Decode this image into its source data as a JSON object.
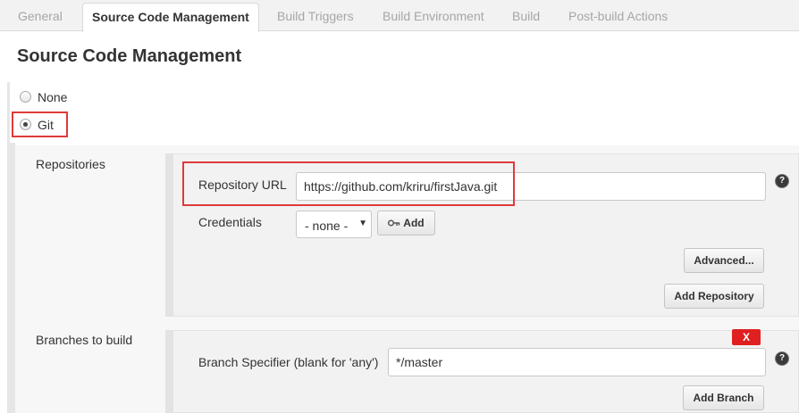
{
  "tabs": [
    {
      "label": "General",
      "active": false
    },
    {
      "label": "Source Code Management",
      "active": true
    },
    {
      "label": "Build Triggers",
      "active": false
    },
    {
      "label": "Build Environment",
      "active": false
    },
    {
      "label": "Build",
      "active": false
    },
    {
      "label": "Post-build Actions",
      "active": false
    }
  ],
  "section_title": "Source Code Management",
  "scm_options": [
    {
      "label": "None",
      "selected": false
    },
    {
      "label": "Git",
      "selected": true
    }
  ],
  "repositories": {
    "label": "Repositories",
    "url_label": "Repository URL",
    "url_value": "https://github.com/kriru/firstJava.git",
    "credentials_label": "Credentials",
    "credentials_value": "- none -",
    "add_label": "Add",
    "advanced_label": "Advanced...",
    "add_repository_label": "Add Repository"
  },
  "branches": {
    "label": "Branches to build",
    "delete_label": "X",
    "specifier_label": "Branch Specifier (blank for 'any')",
    "specifier_value": "*/master",
    "add_branch_label": "Add Branch"
  },
  "colors": {
    "highlight": "#e03a3a",
    "delete_button": "#e02020",
    "inactive_tab_text": "#a6a6a6"
  },
  "icons": {
    "help": "question-circle-icon",
    "key": "key-icon",
    "dropdown": "chevron-down-icon",
    "radio": "radio-button-icon"
  }
}
